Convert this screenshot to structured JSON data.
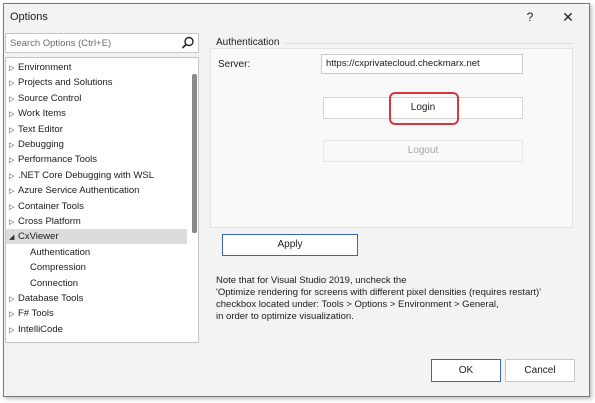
{
  "window": {
    "title": "Options",
    "help_label": "?",
    "close_label": "✕"
  },
  "search": {
    "placeholder": "Search Options (Ctrl+E)"
  },
  "tree": {
    "items": [
      {
        "arrow": "▷",
        "label": "Environment"
      },
      {
        "arrow": "▷",
        "label": "Projects and Solutions"
      },
      {
        "arrow": "▷",
        "label": "Source Control"
      },
      {
        "arrow": "▷",
        "label": "Work Items"
      },
      {
        "arrow": "▷",
        "label": "Text Editor"
      },
      {
        "arrow": "▷",
        "label": "Debugging"
      },
      {
        "arrow": "▷",
        "label": "Performance Tools"
      },
      {
        "arrow": "▷",
        "label": ".NET Core Debugging with WSL"
      },
      {
        "arrow": "▷",
        "label": "Azure Service Authentication"
      },
      {
        "arrow": "▷",
        "label": "Container Tools"
      },
      {
        "arrow": "▷",
        "label": "Cross Platform"
      },
      {
        "arrow": "◢",
        "label": "CxViewer"
      },
      {
        "arrow": "",
        "label": "Authentication"
      },
      {
        "arrow": "",
        "label": "Compression"
      },
      {
        "arrow": "",
        "label": "Connection"
      },
      {
        "arrow": "▷",
        "label": "Database Tools"
      },
      {
        "arrow": "▷",
        "label": "F# Tools"
      },
      {
        "arrow": "▷",
        "label": "IntelliCode"
      }
    ]
  },
  "auth": {
    "section_title": "Authentication",
    "server_label": "Server:",
    "server_value": "https://cxprivatecloud.checkmarx.net",
    "login_label": "Login",
    "logout_label": "Logout",
    "apply_label": "Apply"
  },
  "note": {
    "lines": [
      "Note that for Visual Studio 2019, uncheck the",
      "'Optimize rendering for screens with different pixel densities (requires restart)'",
      "checkbox located under: Tools > Options > Environment > General,",
      "in order to optimize visualization."
    ]
  },
  "footer": {
    "ok_label": "OK",
    "cancel_label": "Cancel"
  },
  "colors": {
    "accent": "#3a64ad",
    "highlight": "#d9363e",
    "selection": "#dcdcdc"
  }
}
